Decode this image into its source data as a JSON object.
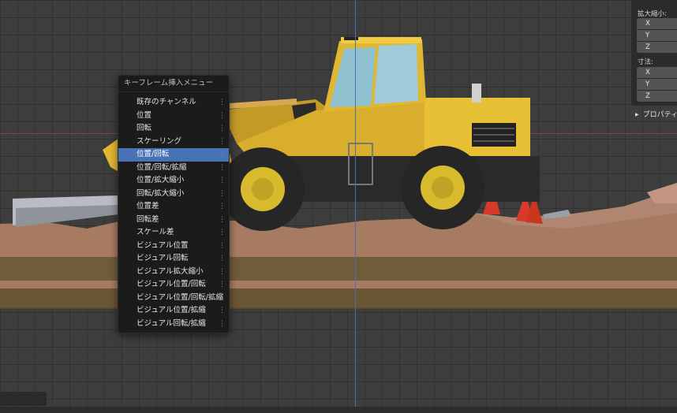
{
  "menu": {
    "title": "キーフレーム挿入メニュー",
    "items": [
      {
        "label": "既存のチャンネル"
      },
      {
        "label": "位置"
      },
      {
        "label": "回転"
      },
      {
        "label": "スケーリング"
      },
      {
        "label": "位置/回転"
      },
      {
        "label": "位置/回転/拡縮"
      },
      {
        "label": "位置/拡大縮小"
      },
      {
        "label": "回転/拡大縮小"
      },
      {
        "label": "位置差"
      },
      {
        "label": "回転差"
      },
      {
        "label": "スケール差"
      },
      {
        "label": "ビジュアル位置"
      },
      {
        "label": "ビジュアル回転"
      },
      {
        "label": "ビジュアル拡大縮小"
      },
      {
        "label": "ビジュアル位置/回転"
      },
      {
        "label": "ビジュアル位置/回転/拡縮"
      },
      {
        "label": "ビジュアル位置/拡縮"
      },
      {
        "label": "ビジュアル回転/拡縮"
      }
    ],
    "active_index": 4,
    "item_marker": "⋮"
  },
  "properties": {
    "scale_label": "拡大縮小:",
    "dimensions_label": "寸法:",
    "scale_fields": [
      "X",
      "Y",
      "Z"
    ],
    "dimension_fields": [
      "X",
      "Y",
      "Z"
    ],
    "section_label": "プロパティ"
  },
  "colors": {
    "active_item": "#4772b3",
    "x_axis": "#9c3a4c",
    "z_axis": "#4a6fb0",
    "loader_yellow": "#e8c036"
  }
}
